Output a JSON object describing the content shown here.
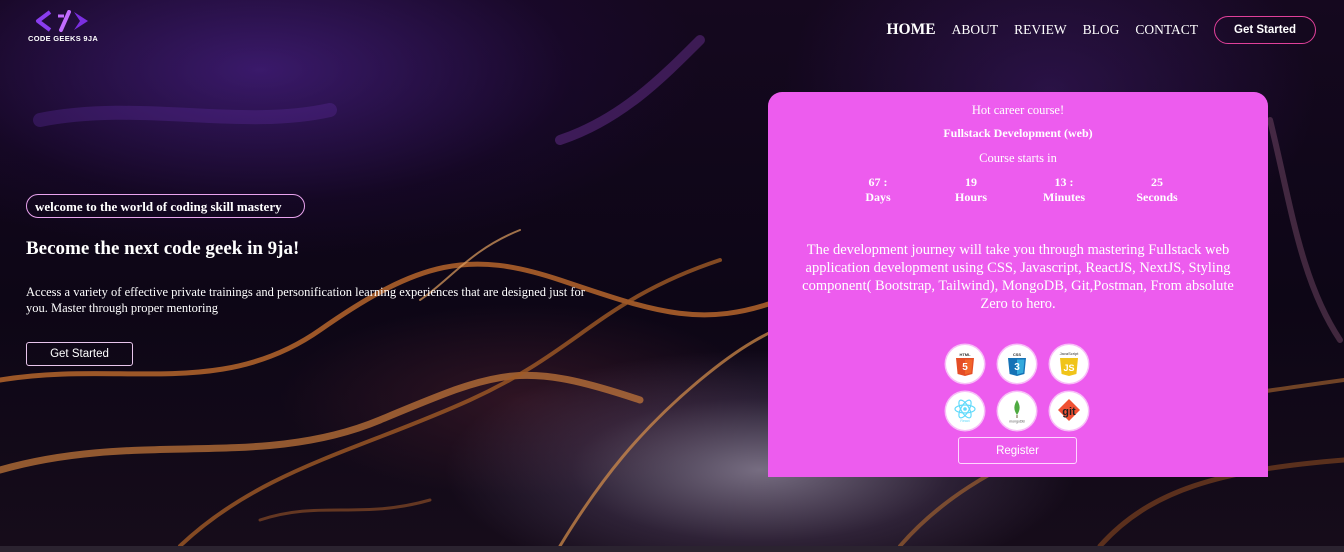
{
  "brand": {
    "name": "CODE GEEKS 9JA",
    "accent": "#e0409a",
    "card_color": "#ed5cee"
  },
  "nav": {
    "items": [
      {
        "label": "HOME",
        "active": true
      },
      {
        "label": "ABOUT",
        "active": false
      },
      {
        "label": "REVIEW",
        "active": false
      },
      {
        "label": "BLOG",
        "active": false
      },
      {
        "label": "CONTACT",
        "active": false
      }
    ],
    "cta_label": "Get Started"
  },
  "hero": {
    "tagline": "welcome to the world of coding skill mastery",
    "headline": "Become the next code geek in 9ja!",
    "description": "Access a variety of effective private trainings and personification learning experiences that are designed just for you. Master through proper mentoring",
    "cta_label": "Get Started"
  },
  "course_card": {
    "tag": "Hot career course!",
    "course": "Fullstack Development (web)",
    "starts_label": "Course starts in",
    "countdown": [
      {
        "value": "67 :",
        "unit": "Days"
      },
      {
        "value": "19",
        "unit": "Hours"
      },
      {
        "value": "13 :",
        "unit": "Minutes"
      },
      {
        "value": "25",
        "unit": "Seconds"
      }
    ],
    "description": "The development journey will take you through mastering Fullstack web application development using CSS, Javascript, ReactJS, NextJS, Styling component( Bootstrap, Tailwind), MongoDB, Git,Postman, From absolute Zero to hero.",
    "tech_icons": [
      "html5-icon",
      "css3-icon",
      "javascript-icon",
      "react-icon",
      "mongodb-icon",
      "git-icon"
    ],
    "tech_labels": {
      "html": "HTML",
      "css": "CSS",
      "js": "JavaScript",
      "js_letter": "JS",
      "react": "React",
      "mongo": "mongoDB",
      "git": "git"
    },
    "register_label": "Register"
  }
}
